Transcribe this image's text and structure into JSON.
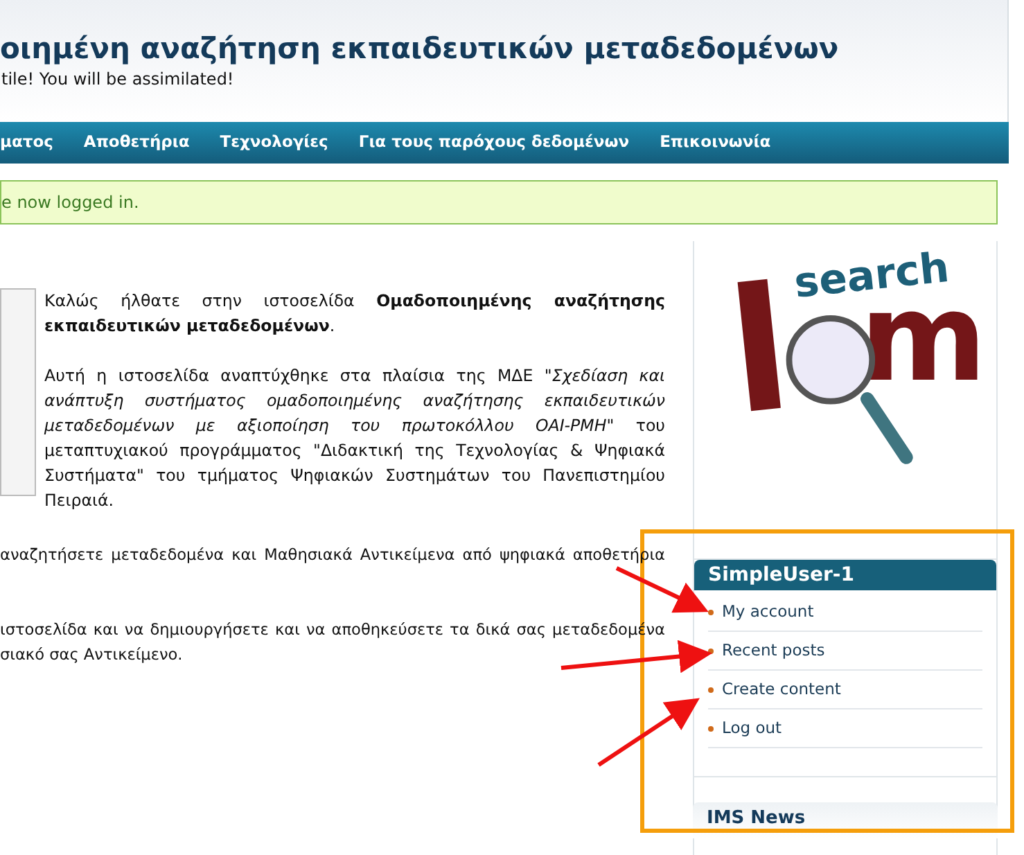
{
  "header": {
    "title": "οιημένη αναζήτηση εκπαιδευτικών μεταδεδομένων",
    "slogan": "tile! You will be assimilated!"
  },
  "nav": [
    "ματος",
    "Αποθετήρια",
    "Τεχνολογίες",
    "Για τους παρόχους δεδομένων",
    "Επικοινωνία"
  ],
  "message": "e now logged in.",
  "content": {
    "intro": "Καλώς ήλθατε στην ιστοσελίδα **Ομαδοποιημένης αναζήτησης εκπαιδευτικών μεταδεδομένων**.",
    "about": "Αυτή η ιστοσελίδα αναπτύχθηκε στα πλαίσια της ΜΔΕ *\"Σχεδίαση και ανάπτυξη συστήματος ομαδοποιημένης αναζήτησης εκπαιδευτικών μεταδεδομένων με αξιοποίηση του πρωτοκόλλου OAI-PMH\"* του μεταπτυχιακού προγράμματος \"Διδακτική της Τεχνολογίας & Ψηφιακά Συστήματα\" του τμήματος Ψηφιακών Συστημάτων του Πανεπιστημίου Πειραιά.",
    "paragraphs": [
      [
        "αναζητήσετε μεταδεδομένα και Μαθησιακά Αντικείμενα από ψηφιακά αποθετήρια"
      ],
      [
        "ιστοσελίδα και να δημιουργήσετε και να αποθηκεύσετε τα δικά σας μεταδεδομένα",
        "σιακό σας Αντικείμενο."
      ]
    ]
  },
  "logo": {
    "word": "search",
    "letters": [
      "l",
      "m"
    ]
  },
  "user_block": {
    "title": "SimpleUser-1",
    "items": [
      "My account",
      "Recent posts",
      "Create content",
      "Log out"
    ]
  },
  "news_block": {
    "title": "IMS News"
  }
}
